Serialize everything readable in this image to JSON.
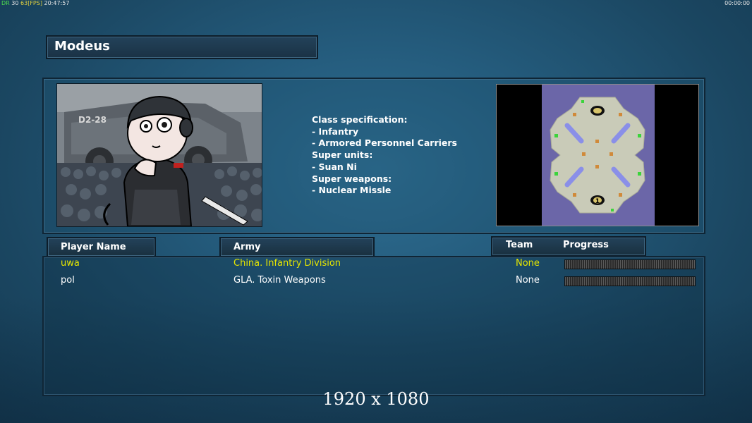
{
  "hud": {
    "left_prefix": "DR",
    "left_val1": "30",
    "left_val2": "63",
    "left_fps": "FPS",
    "left_clock": "20:47:57",
    "right_timer": "00:00:00"
  },
  "map_title": "Modeus",
  "class_spec": {
    "lines": [
      "Class specification:",
      "- Infantry",
      "- Armored Personnel Carriers",
      "Super units:",
      "- Suan Ni",
      "Super weapons:",
      "- Nuclear Missle"
    ]
  },
  "minimap": {
    "player_marker": "1"
  },
  "table": {
    "headers": {
      "player_name": "Player Name",
      "army": "Army",
      "team": "Team",
      "progress": "Progress"
    },
    "rows": [
      {
        "player": "uwa",
        "army": "China. Infantry Division",
        "team": "None",
        "progress": 0,
        "color": "#e6e600"
      },
      {
        "player": "pol",
        "army": "GLA. Toxin Weapons",
        "team": "None",
        "progress": 0,
        "color": "#ffffff"
      }
    ]
  },
  "resolution_label": "1920 x 1080"
}
